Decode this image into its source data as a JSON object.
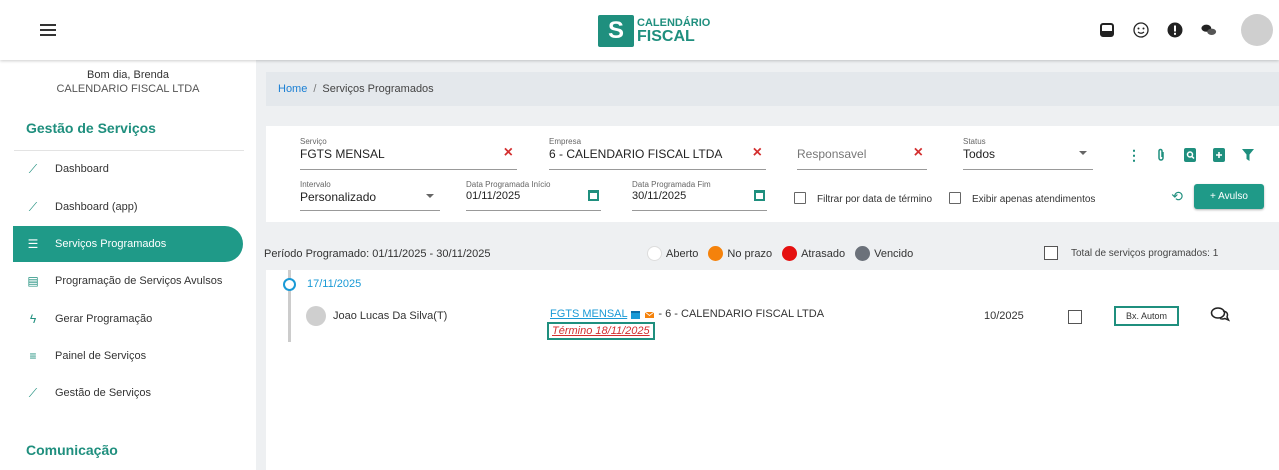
{
  "header": {
    "logo_line1": "CALENDÁRIO",
    "logo_line2": "FISCAL",
    "icons": [
      "inbox-icon",
      "smiley-icon",
      "alert-icon",
      "chat-icon",
      "avatar"
    ]
  },
  "sidebar": {
    "greeting": "Bom dia, Brenda",
    "company": "CALENDARIO FISCAL LTDA",
    "section1_title": "Gestão de Serviços",
    "items": [
      {
        "label": "Dashboard",
        "icon": "chart-icon"
      },
      {
        "label": "Dashboard (app)",
        "icon": "chart-icon"
      },
      {
        "label": "Serviços Programados",
        "icon": "list-icon",
        "active": true
      },
      {
        "label": "Programação de Serviços Avulsos",
        "icon": "table-icon"
      },
      {
        "label": "Gerar Programação",
        "icon": "bolt-icon"
      },
      {
        "label": "Painel de Serviços",
        "icon": "list-icon"
      },
      {
        "label": "Gestão de Serviços",
        "icon": "chart-icon"
      }
    ],
    "section2_title": "Comunicação"
  },
  "breadcrumb": {
    "home": "Home",
    "separator": "/",
    "current": "Serviços Programados"
  },
  "filters": {
    "servico_label": "Serviço",
    "servico_value": "FGTS MENSAL",
    "empresa_label": "Empresa",
    "empresa_value": "6 - CALENDARIO FISCAL LTDA",
    "responsavel_placeholder": "Responsavel",
    "status_label": "Status",
    "status_value": "Todos",
    "intervalo_label": "Intervalo",
    "intervalo_value": "Personalizado",
    "data_inicio_label": "Data Programada Início",
    "data_inicio_value": "01/11/2025",
    "data_fim_label": "Data Programada Fim",
    "data_fim_value": "30/11/2025",
    "filtrar_termino_label": "Filtrar por data de término",
    "exibir_atendimentos_label": "Exibir apenas atendimentos",
    "avulso_button": "+ Avulso"
  },
  "period": {
    "text": "Período Programado: 01/11/2025 - 30/11/2025",
    "legend": [
      {
        "label": "Aberto",
        "color": "#ffffff"
      },
      {
        "label": "No prazo",
        "color": "#f5820b"
      },
      {
        "label": "Atrasado",
        "color": "#e51010"
      },
      {
        "label": "Vencido",
        "color": "#6b717a"
      }
    ],
    "total_label": "Total de serviços programados: 1"
  },
  "timeline": {
    "date": "17/11/2025",
    "row": {
      "responsible": "Joao Lucas Da Silva(T)",
      "service_link": "FGTS MENSAL",
      "service_rest": "- 6 - CALENDARIO FISCAL LTDA",
      "termino": "Término 18/11/2025",
      "competencia": "10/2025",
      "action_label": "Bx. Autom"
    }
  }
}
